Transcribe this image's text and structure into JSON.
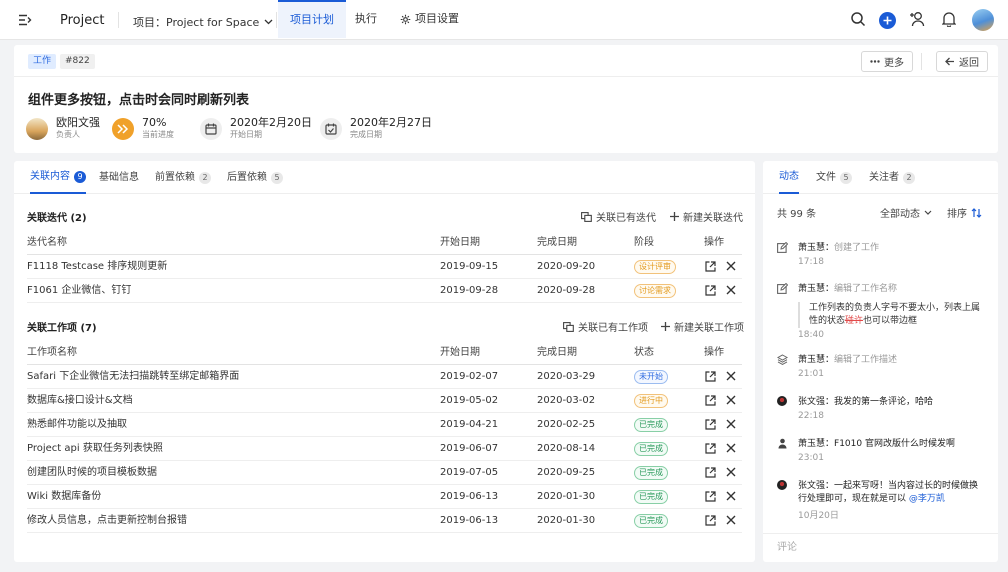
{
  "topbar": {
    "brand": "Project",
    "project_label": "项目：Project for Space",
    "tabs": [
      "项目计划",
      "执行",
      "项目设置"
    ]
  },
  "header": {
    "tag_type": "工作",
    "tag_id": "#822",
    "more_label": "更多",
    "back_label": "返回",
    "title": "组件更多按钮，点击时会同时刷新列表",
    "assignee": {
      "name": "欧阳文强",
      "label": "负责人"
    },
    "progress": {
      "value": "70%",
      "label": "当前进度"
    },
    "start": {
      "value": "2020年2月20日",
      "label": "开始日期"
    },
    "end": {
      "value": "2020年2月27日",
      "label": "完成日期"
    }
  },
  "main": {
    "tabs": [
      {
        "label": "关联内容",
        "count": "9"
      },
      {
        "label": "基础信息",
        "count": ""
      },
      {
        "label": "前置依赖",
        "count": "2"
      },
      {
        "label": "后置依赖",
        "count": "5"
      }
    ],
    "iterations": {
      "title": "关联迭代 (2)",
      "link_label": "关联已有迭代",
      "new_label": "新建关联迭代",
      "headers": [
        "迭代名称",
        "开始日期",
        "完成日期",
        "阶段",
        "操作"
      ],
      "rows": [
        {
          "name": "F1118 Testcase 排序规则更新",
          "start": "2019-09-15",
          "end": "2020-09-20",
          "stage": "设计评审"
        },
        {
          "name": "F1061 企业微信、钉钉",
          "start": "2019-09-28",
          "end": "2020-09-28",
          "stage": "讨论需求"
        }
      ]
    },
    "items": {
      "title": "关联工作项 (7)",
      "link_label": "关联已有工作项",
      "new_label": "新建关联工作项",
      "headers": [
        "工作项名称",
        "开始日期",
        "完成日期",
        "状态",
        "操作"
      ],
      "rows": [
        {
          "name": "Safari 下企业微信无法扫描跳转至绑定邮箱界面",
          "start": "2019-02-07",
          "end": "2020-03-29",
          "status": "未开始"
        },
        {
          "name": "数据库&接口设计&文档",
          "start": "2019-05-02",
          "end": "2020-03-02",
          "status": "进行中"
        },
        {
          "name": "熟悉邮件功能以及抽取",
          "start": "2019-04-21",
          "end": "2020-02-25",
          "status": "已完成"
        },
        {
          "name": "Project api 获取任务列表快照",
          "start": "2019-06-07",
          "end": "2020-08-14",
          "status": "已完成"
        },
        {
          "name": "创建团队时候的项目模板数据",
          "start": "2019-07-05",
          "end": "2020-09-25",
          "status": "已完成"
        },
        {
          "name": "Wiki 数据库备份",
          "start": "2019-06-13",
          "end": "2020-01-30",
          "status": "已完成"
        },
        {
          "name": "修改人员信息，点击更新控制台报错",
          "start": "2019-06-13",
          "end": "2020-01-30",
          "status": "已完成"
        }
      ]
    }
  },
  "side": {
    "tabs": [
      {
        "label": "动态",
        "count": ""
      },
      {
        "label": "文件",
        "count": "5"
      },
      {
        "label": "关注者",
        "count": "2"
      }
    ],
    "total": "共 99 条",
    "filter": "全部动态",
    "sort": "排序",
    "activities": [
      {
        "user": "萧玉慧",
        "action": "创建了工作",
        "time": "17:18"
      },
      {
        "user": "萧玉慧",
        "action": "编辑了工作名称",
        "quote_a": "工作列表的负责人字号不要太小，列表上属性的状态",
        "quote_del": "碰许",
        "quote_b": "也可以带边框",
        "time": "18:40"
      },
      {
        "user": "萧玉慧",
        "action": "编辑了工作描述",
        "time": "21:01"
      },
      {
        "user": "张文强",
        "text": "我发的第一条评论，哈哈",
        "time": "22:18"
      },
      {
        "user": "萧玉慧",
        "text": "F1010 官网改版什么时候发啊",
        "time": "23:01"
      },
      {
        "user": "张文强",
        "text": "一起来写呀！当内容过长的时候做换行处理即可，现在就是可以 ",
        "mention": "@李万凯",
        "time": "10月20日"
      }
    ],
    "comment_placeholder": "评论"
  }
}
